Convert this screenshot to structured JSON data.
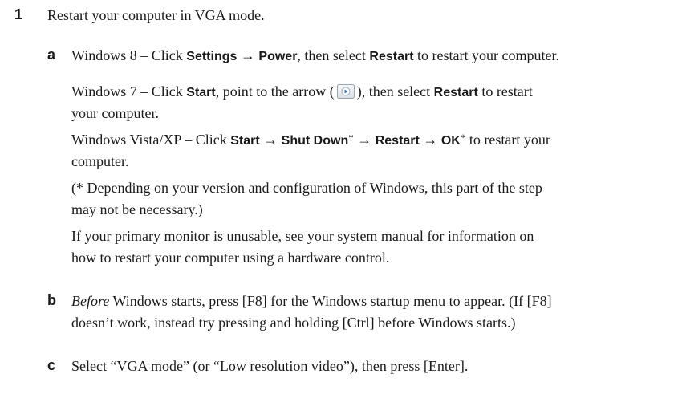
{
  "step1": {
    "number": "1",
    "text": "Restart your computer in VGA mode."
  },
  "sub_a": {
    "letter": "a",
    "win8": {
      "label": "Windows 8",
      "sep": " – Click ",
      "settings": "Settings",
      "arrow": " → ",
      "power": "Power",
      "then_select": ", then select ",
      "restart": "Restart",
      "tail": " to restart your computer."
    },
    "win7": {
      "label": "Windows 7",
      "sep": " – Click ",
      "start": "Start",
      "point_to": ", point to the arrow (",
      "arrow_icon": "play-arrow-button-icon",
      "close_paren": "), then select ",
      "restart": "Restart",
      "tail_1": " to restart",
      "tail_2": "your computer."
    },
    "vista": {
      "label": "Windows Vista/XP",
      "sep": " – Click ",
      "start": "Start",
      "arrow": " → ",
      "shutdown": "Shut Down",
      "star": "*",
      "restart": "Restart",
      "ok": "OK",
      "tail_1": " to restart your",
      "tail_2": "computer."
    },
    "note": {
      "line_1": "(* Depending on your version and configuration of Windows, this part of the step",
      "line_2": "may not be necessary.)"
    },
    "monitor": {
      "line_1": "If your primary monitor is unusable, see your system manual for information on",
      "line_2": "how to restart your computer using a hardware control."
    }
  },
  "sub_b": {
    "letter": "b",
    "before": "Before",
    "line_1_rest": " Windows starts, press [F8] for the Windows startup menu to appear. (If [F8]",
    "line_2": "doesn’t work, instead try pressing and holding [Ctrl] before Windows starts.)"
  },
  "sub_c": {
    "letter": "c",
    "text": "Select “VGA mode” (or “Low resolution video”), then press [Enter]."
  },
  "colors": {
    "text": "#1a1a1a",
    "icon_border": "#9aa4ae",
    "icon_fill_top": "#f7f9fb",
    "icon_fill_bottom": "#d9dfe5",
    "icon_arrow": "#3a6fb0"
  }
}
